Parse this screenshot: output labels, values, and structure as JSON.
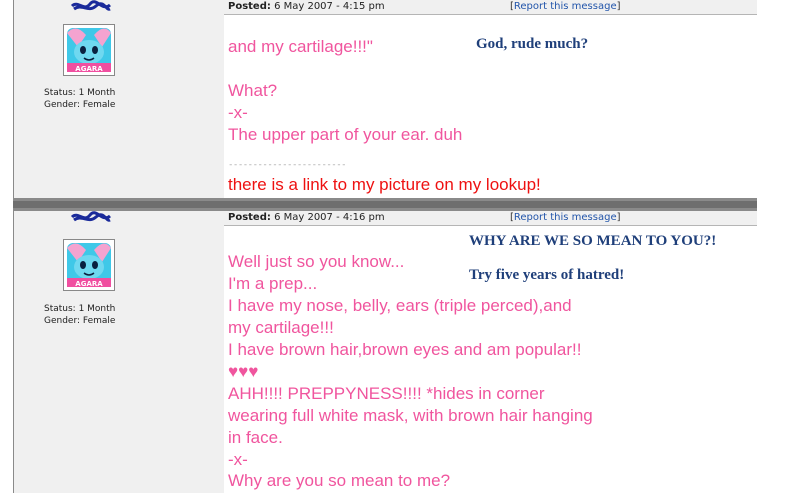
{
  "posts": [
    {
      "user": {
        "status": "Status: 1 Month",
        "gender": "Gender: Female",
        "avatar_label": "AGARA"
      },
      "header": {
        "posted_label": "Posted:",
        "date": "6 May 2007 - 4:15 pm",
        "report_open": "[",
        "report_link": "Report this message",
        "report_close": "]"
      },
      "lines": [
        "and my cartilage!!!\"",
        "",
        "What?",
        "-x-",
        "The upper part of your ear. duh"
      ],
      "signature_rule": "------------------------",
      "signature": "there is a link to my picture on my lookup!",
      "notes": [
        "God, rude much?"
      ]
    },
    {
      "user": {
        "status": "Status: 1 Month",
        "gender": "Gender: Female",
        "avatar_label": "AGARA"
      },
      "header": {
        "posted_label": "Posted:",
        "date": "6 May 2007 - 4:16 pm",
        "report_open": "[",
        "report_link": "Report this message",
        "report_close": "]"
      },
      "lines": [
        "Well just so you know...",
        "I'm a prep...",
        "I have my nose, belly, ears (triple perced),and",
        "my cartilage!!!",
        "I have brown hair,brown eyes and am popular!!",
        "♥♥♥",
        "AHH!!!! PREPPYNESS!!!! *hides in corner",
        "wearing full white mask, with brown hair hanging",
        "in face.",
        "-x-",
        "Why are you so mean to me?"
      ],
      "notes": [
        "WHY ARE WE SO MEAN TO YOU?!",
        "Try five years of hatred!"
      ]
    }
  ],
  "colors": {
    "post_text": "#f0559e",
    "signature_text": "#ee1111",
    "note_text": "#1f3f7a",
    "link": "#2255aa"
  }
}
